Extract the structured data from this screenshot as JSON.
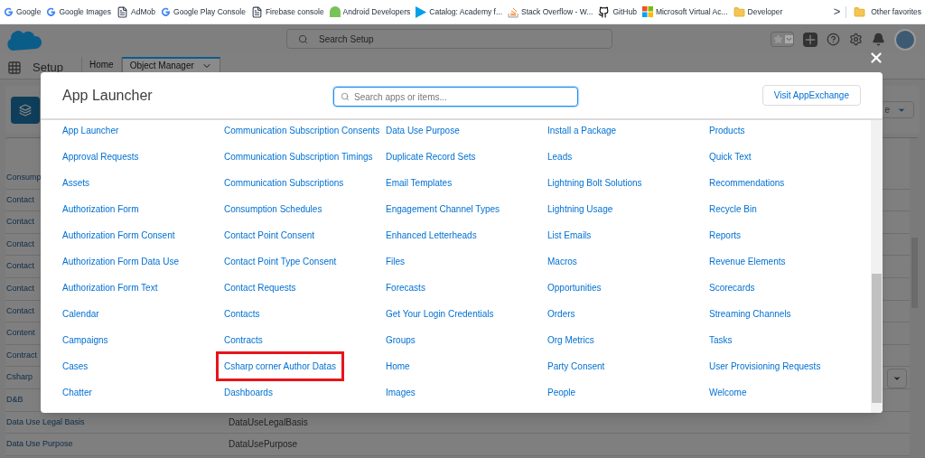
{
  "bookmarks": [
    {
      "label": "Google",
      "kind": "google"
    },
    {
      "label": "Google Images",
      "kind": "google"
    },
    {
      "label": "AdMob",
      "kind": "page"
    },
    {
      "label": "Google Play Console",
      "kind": "google"
    },
    {
      "label": "Firebase console",
      "kind": "page"
    },
    {
      "label": "Android Developers",
      "kind": "android"
    },
    {
      "label": "Catalog: Academy f...",
      "kind": "play"
    },
    {
      "label": "Stack Overflow - W...",
      "kind": "stack"
    },
    {
      "label": "GitHub",
      "kind": "github"
    },
    {
      "label": "Microsoft Virtual Ac...",
      "kind": "ms"
    },
    {
      "label": "Developer",
      "kind": "folder"
    }
  ],
  "bookmarks_more": ">",
  "other_favorites": "Other favorites",
  "header": {
    "search_placeholder": "Search Setup"
  },
  "nav": {
    "app": "Setup",
    "tabs": [
      {
        "label": "Home",
        "selected": false
      },
      {
        "label": "Object Manager",
        "selected": true
      }
    ]
  },
  "background": {
    "dropdown": "e",
    "rows": [
      {
        "name": "Consump",
        "api": ""
      },
      {
        "name": "Contact",
        "api": ""
      },
      {
        "name": "Contact",
        "api": ""
      },
      {
        "name": "Contact",
        "api": ""
      },
      {
        "name": "Contact",
        "api": ""
      },
      {
        "name": "Contact",
        "api": ""
      },
      {
        "name": "Contact",
        "api": ""
      },
      {
        "name": "Content",
        "api": ""
      },
      {
        "name": "Contract",
        "api": ""
      },
      {
        "name": "Csharp",
        "api": ""
      },
      {
        "name": "D&B",
        "api": ""
      },
      {
        "name": "Data Use Legal Basis",
        "api": "DataUseLegalBasis"
      },
      {
        "name": "Data Use Purpose",
        "api": "DataUsePurpose"
      }
    ]
  },
  "modal": {
    "title": "App Launcher",
    "search_placeholder": "Search apps or items...",
    "button": "Visit AppExchange",
    "columns": [
      [
        {
          "label": "App Launcher",
          "highlighted": false
        },
        {
          "label": "Approval Requests",
          "highlighted": false
        },
        {
          "label": "Assets",
          "highlighted": false
        },
        {
          "label": "Authorization Form",
          "highlighted": false
        },
        {
          "label": "Authorization Form Consent",
          "highlighted": false
        },
        {
          "label": "Authorization Form Data Use",
          "highlighted": false
        },
        {
          "label": "Authorization Form Text",
          "highlighted": false
        },
        {
          "label": "Calendar",
          "highlighted": false
        },
        {
          "label": "Campaigns",
          "highlighted": false
        },
        {
          "label": "Cases",
          "highlighted": false
        },
        {
          "label": "Chatter",
          "highlighted": false
        }
      ],
      [
        {
          "label": "Communication Subscription Consents",
          "highlighted": false
        },
        {
          "label": "Communication Subscription Timings",
          "highlighted": false
        },
        {
          "label": "Communication Subscriptions",
          "highlighted": false
        },
        {
          "label": "Consumption Schedules",
          "highlighted": false
        },
        {
          "label": "Contact Point Consent",
          "highlighted": false
        },
        {
          "label": "Contact Point Type Consent",
          "highlighted": false
        },
        {
          "label": "Contact Requests",
          "highlighted": false
        },
        {
          "label": "Contacts",
          "highlighted": false
        },
        {
          "label": "Contracts",
          "highlighted": false
        },
        {
          "label": "Csharp corner Author Datas",
          "highlighted": true
        },
        {
          "label": "Dashboards",
          "highlighted": false
        }
      ],
      [
        {
          "label": "Data Use Purpose",
          "highlighted": false
        },
        {
          "label": "Duplicate Record Sets",
          "highlighted": false
        },
        {
          "label": "Email Templates",
          "highlighted": false
        },
        {
          "label": "Engagement Channel Types",
          "highlighted": false
        },
        {
          "label": "Enhanced Letterheads",
          "highlighted": false
        },
        {
          "label": "Files",
          "highlighted": false
        },
        {
          "label": "Forecasts",
          "highlighted": false
        },
        {
          "label": "Get Your Login Credentials",
          "highlighted": false
        },
        {
          "label": "Groups",
          "highlighted": false
        },
        {
          "label": "Home",
          "highlighted": false
        },
        {
          "label": "Images",
          "highlighted": false
        }
      ],
      [
        {
          "label": "Install a Package",
          "highlighted": false
        },
        {
          "label": "Leads",
          "highlighted": false
        },
        {
          "label": "Lightning Bolt Solutions",
          "highlighted": false
        },
        {
          "label": "Lightning Usage",
          "highlighted": false
        },
        {
          "label": "List Emails",
          "highlighted": false
        },
        {
          "label": "Macros",
          "highlighted": false
        },
        {
          "label": "Opportunities",
          "highlighted": false
        },
        {
          "label": "Orders",
          "highlighted": false
        },
        {
          "label": "Org Metrics",
          "highlighted": false
        },
        {
          "label": "Party Consent",
          "highlighted": false
        },
        {
          "label": "People",
          "highlighted": false
        }
      ],
      [
        {
          "label": "Products",
          "highlighted": false
        },
        {
          "label": "Quick Text",
          "highlighted": false
        },
        {
          "label": "Recommendations",
          "highlighted": false
        },
        {
          "label": "Recycle Bin",
          "highlighted": false
        },
        {
          "label": "Reports",
          "highlighted": false
        },
        {
          "label": "Revenue Elements",
          "highlighted": false
        },
        {
          "label": "Scorecards",
          "highlighted": false
        },
        {
          "label": "Streaming Channels",
          "highlighted": false
        },
        {
          "label": "Tasks",
          "highlighted": false
        },
        {
          "label": "User Provisioning Requests",
          "highlighted": false
        },
        {
          "label": "Welcome",
          "highlighted": false
        }
      ]
    ]
  }
}
